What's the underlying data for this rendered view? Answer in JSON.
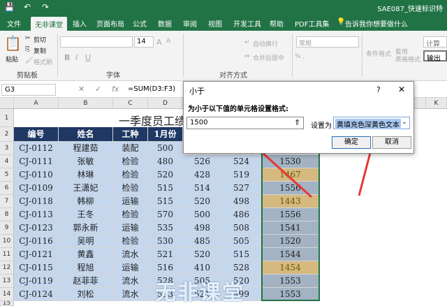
{
  "title_bar": {
    "doc_name": "SAE087_快速标识特"
  },
  "quick_access": {
    "save": "💾",
    "undo": "↶",
    "redo": "↷"
  },
  "tabs": [
    "文件",
    "无非课堂",
    "插入",
    "页面布局",
    "公式",
    "数据",
    "审阅",
    "视图",
    "开发工具",
    "帮助",
    "PDF工具集"
  ],
  "tell_me": "告诉我你想要做什么",
  "ribbon": {
    "paste": "粘贴",
    "cut": "剪切",
    "copy": "复制",
    "format_painter": "格式刷",
    "clipboard_label": "剪贴板",
    "font_size": "14",
    "font_label": "字体",
    "wrap_text": "自动换行",
    "merge_center": "合并后居中",
    "align_label": "对齐方式",
    "number_format": "常规",
    "cond_format": "条件格式",
    "table_format": "套用\n表格格式",
    "calc": "计算",
    "output": "输出"
  },
  "formula_bar": {
    "name_box": "G3",
    "cancel": "✕",
    "enter": "✓",
    "fx": "fx",
    "formula": "=SUM(D3:F3)"
  },
  "columns": [
    "A",
    "B",
    "C",
    "D",
    "E",
    "F",
    "G",
    "H",
    "I",
    "J",
    "K"
  ],
  "rows": [
    "1",
    "2",
    "3",
    "4",
    "5",
    "6",
    "7",
    "8",
    "9",
    "10",
    "11",
    "12",
    "13",
    "14",
    "15"
  ],
  "sheet": {
    "title": "一季度员工绩",
    "headers": [
      "编号",
      "姓名",
      "工种",
      "1月份"
    ],
    "data": [
      [
        "CJ-0112",
        "程建茹",
        "装配",
        "500",
        "",
        "",
        ""
      ],
      [
        "CJ-0111",
        "张敏",
        "检验",
        "480",
        "526",
        "524",
        "1530"
      ],
      [
        "CJ-0110",
        "林琳",
        "检验",
        "520",
        "428",
        "519",
        "1467"
      ],
      [
        "CJ-0109",
        "王潇妃",
        "检验",
        "515",
        "514",
        "527",
        "1556"
      ],
      [
        "CJ-0118",
        "韩柳",
        "运输",
        "515",
        "520",
        "498",
        "1443"
      ],
      [
        "CJ-0113",
        "王冬",
        "检验",
        "570",
        "500",
        "486",
        "1556"
      ],
      [
        "CJ-0123",
        "郭永新",
        "运输",
        "535",
        "498",
        "508",
        "1541"
      ],
      [
        "CJ-0116",
        "吴明",
        "检验",
        "530",
        "485",
        "505",
        "1520"
      ],
      [
        "CJ-0121",
        "黄鑫",
        "流水",
        "521",
        "520",
        "515",
        "1544"
      ],
      [
        "CJ-0115",
        "程旭",
        "运输",
        "516",
        "410",
        "528",
        "1454"
      ],
      [
        "CJ-0119",
        "赵菲菲",
        "流水",
        "528",
        "505",
        "520",
        "1553"
      ],
      [
        "CJ-0124",
        "刘松",
        "流水",
        "533",
        "521",
        "499",
        "1553"
      ]
    ]
  },
  "dialog": {
    "title": "小于",
    "help": "?",
    "close": "✕",
    "prompt": "为小于以下值的单元格设置格式:",
    "value": "1500",
    "ref": "⇑",
    "set_label": "设置为",
    "format_option": "黄填充色深黄色文本",
    "ok": "确定",
    "cancel": "取消"
  },
  "watermark": "无非课堂"
}
